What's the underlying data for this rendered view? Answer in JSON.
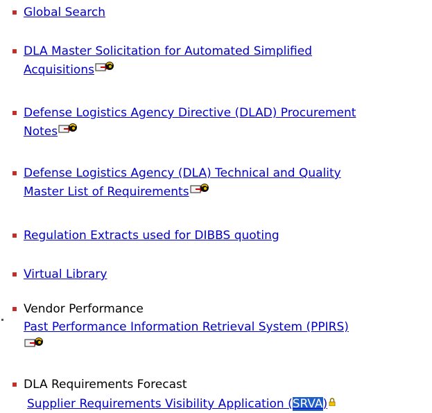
{
  "items": [
    {
      "label": "Global Search"
    },
    {
      "line1": "DLA Master Solicitation for Automated Simplified",
      "line2": "Acquisitions"
    },
    {
      "line1": "Defense Logistics Agency Directive (DLAD) Procurement",
      "line2": "Notes"
    },
    {
      "line1": "Defense Logistics Agency (DLA) Technical and Quality",
      "line2": "Master List of Requirements"
    },
    {
      "label": "Regulation Extracts used for DIBBS quoting"
    },
    {
      "label": "Virtual Library"
    },
    {
      "heading": "Vendor Performance",
      "link": "Past Performance Information Retrieval System (PPIRS)"
    },
    {
      "heading": "DLA Requirements Forecast",
      "link_pre": "Supplier Requirements Visibility Application (",
      "link_hl": "SRVA",
      "link_post": ")"
    }
  ],
  "colors": {
    "link": "#0000c8",
    "bullet": "#c0302a",
    "highlight": "#1f5fc7"
  },
  "icons": {
    "external": "external-link-globe-icon",
    "lock": "lock-icon"
  }
}
